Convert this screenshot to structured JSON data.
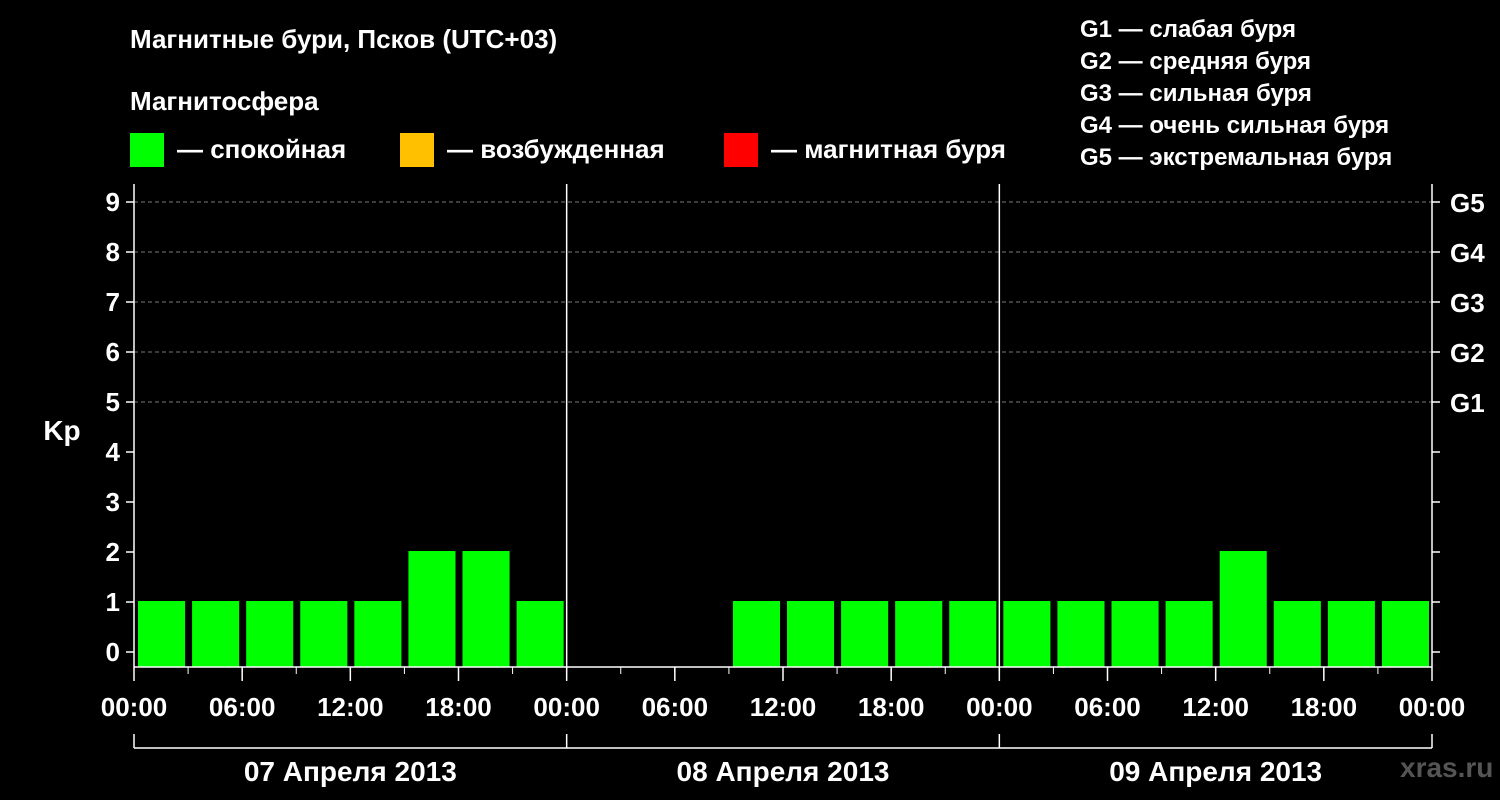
{
  "header": {
    "title": "Магнитные бури, Псков (UTC+03)",
    "legend_heading": "Магнитосфера",
    "legend": [
      {
        "label": "— спокойная",
        "color": "#00ff00"
      },
      {
        "label": "— возбужденная",
        "color": "#ffc000"
      },
      {
        "label": "— магнитная буря",
        "color": "#ff0000"
      }
    ],
    "g_levels": [
      "G1 — слабая буря",
      "G2 — средняя буря",
      "G3 — сильная буря",
      "G4 — очень сильная буря",
      "G5 — экстремальная буря"
    ],
    "watermark": "xras.ru"
  },
  "chart_data": {
    "type": "bar",
    "ylabel": "Kp",
    "ylim": [
      0,
      9
    ],
    "y_ticks": [
      "0",
      "1",
      "2",
      "3",
      "4",
      "5",
      "6",
      "7",
      "8",
      "9"
    ],
    "right_ticks": [
      {
        "value": 5,
        "label": "G1"
      },
      {
        "value": 6,
        "label": "G2"
      },
      {
        "value": 7,
        "label": "G3"
      },
      {
        "value": 8,
        "label": "G4"
      },
      {
        "value": 9,
        "label": "G5"
      }
    ],
    "x_tick_labels": [
      "00:00",
      "06:00",
      "12:00",
      "18:00",
      "00:00",
      "06:00",
      "12:00",
      "18:00",
      "00:00",
      "06:00",
      "12:00",
      "18:00",
      "00:00"
    ],
    "days": [
      "07 Апреля 2013",
      "08 Апреля 2013",
      "09 Апреля 2013"
    ],
    "interval_hours": 3,
    "values": [
      1,
      1,
      1,
      1,
      1,
      2,
      2,
      1,
      null,
      null,
      null,
      1,
      1,
      1,
      1,
      1,
      1,
      1,
      1,
      1,
      2,
      1,
      1,
      1
    ],
    "quiet_color": "#00ff00",
    "grid": "dashed at Kp 5-9",
    "legend_position": "top"
  }
}
